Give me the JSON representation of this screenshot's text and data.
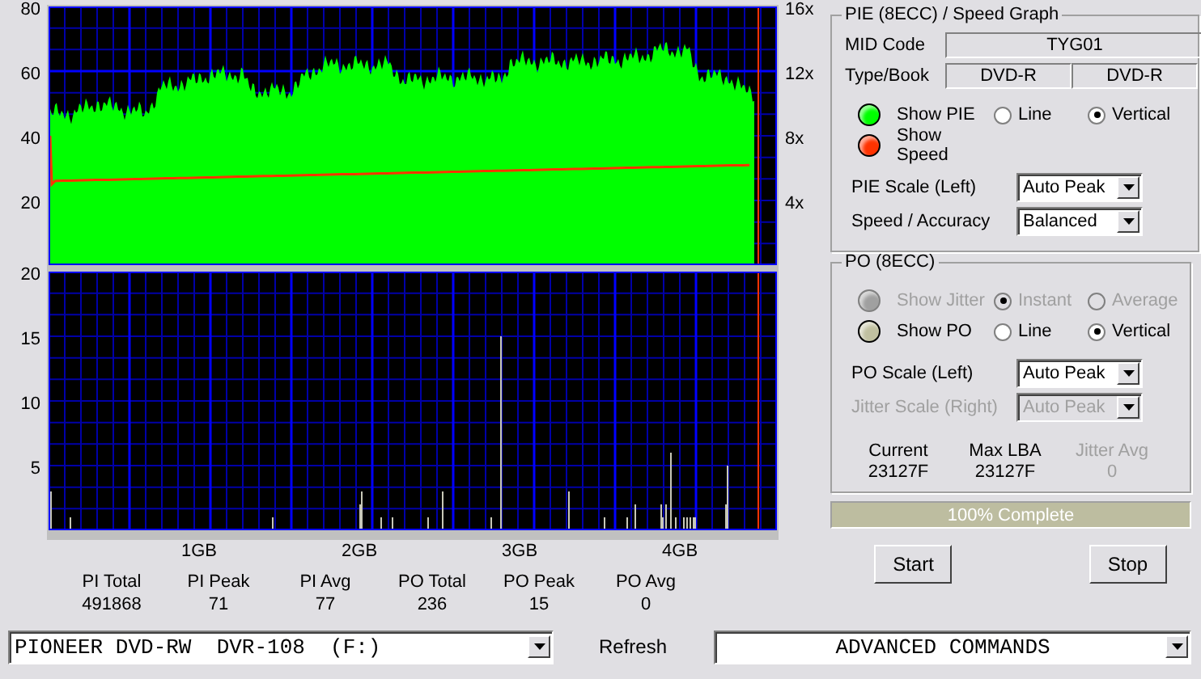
{
  "pie_chart": {
    "left_ticks": [
      "80",
      "60",
      "40",
      "20"
    ],
    "right_ticks": [
      "16x",
      "12x",
      "8x",
      "4x"
    ]
  },
  "po_chart": {
    "left_ticks": [
      "20",
      "15",
      "10",
      "5"
    ]
  },
  "x_ticks": [
    "1GB",
    "2GB",
    "3GB",
    "4GB"
  ],
  "stats": [
    {
      "label": "PI Total",
      "value": "491868"
    },
    {
      "label": "PI Peak",
      "value": "71"
    },
    {
      "label": "PI Avg",
      "value": "77"
    },
    {
      "label": "PO Total",
      "value": "236"
    },
    {
      "label": "PO Peak",
      "value": "15"
    },
    {
      "label": "PO Avg",
      "value": "0"
    }
  ],
  "pie_group": {
    "title": "PIE (8ECC) / Speed Graph",
    "mid_label": "MID Code",
    "mid_code": "TYG01",
    "type_label": "Type/Book",
    "type": "DVD-R",
    "book": "DVD-R",
    "toggles": [
      {
        "label": "Show PIE",
        "color": "#00ff00",
        "disabled": false,
        "options": [
          {
            "label": "Line",
            "selected": false,
            "disabled": false
          },
          {
            "label": "Vertical",
            "selected": true,
            "disabled": false
          }
        ]
      },
      {
        "label": "Show Speed",
        "color": "#ff3300",
        "disabled": false
      }
    ],
    "selects": [
      {
        "label": "PIE Scale (Left)",
        "value": "Auto Peak",
        "disabled": false
      },
      {
        "label": "Speed / Accuracy",
        "value": "Balanced",
        "disabled": false
      }
    ]
  },
  "po_group": {
    "title": "PO (8ECC)",
    "toggles": [
      {
        "label": "Show Jitter",
        "color": "#a0a0a0",
        "disabled": true,
        "options": [
          {
            "label": "Instant",
            "selected": true,
            "disabled": true
          },
          {
            "label": "Average",
            "selected": false,
            "disabled": true
          }
        ]
      },
      {
        "label": "Show PO",
        "color": "#c0c0a0",
        "disabled": false,
        "options": [
          {
            "label": "Line",
            "selected": false,
            "disabled": false
          },
          {
            "label": "Vertical",
            "selected": true,
            "disabled": false
          }
        ]
      }
    ],
    "selects": [
      {
        "label": "PO Scale (Left)",
        "value": "Auto Peak",
        "disabled": false
      },
      {
        "label": "Jitter Scale (Right)",
        "value": "Auto Peak",
        "disabled": true
      }
    ],
    "readouts": [
      {
        "label": "Current",
        "value": "23127F",
        "disabled": false
      },
      {
        "label": "Max LBA",
        "value": "23127F",
        "disabled": false
      },
      {
        "label": "Jitter Avg",
        "value": "0",
        "disabled": true
      }
    ]
  },
  "progress": {
    "label": "100% Complete",
    "level": 1
  },
  "buttons": [
    "Start",
    "Stop"
  ],
  "drive": "PIONEER DVD-RW  DVR-108  (F:)",
  "refresh": "Refresh",
  "commands": "ADVANCED COMMANDS"
}
